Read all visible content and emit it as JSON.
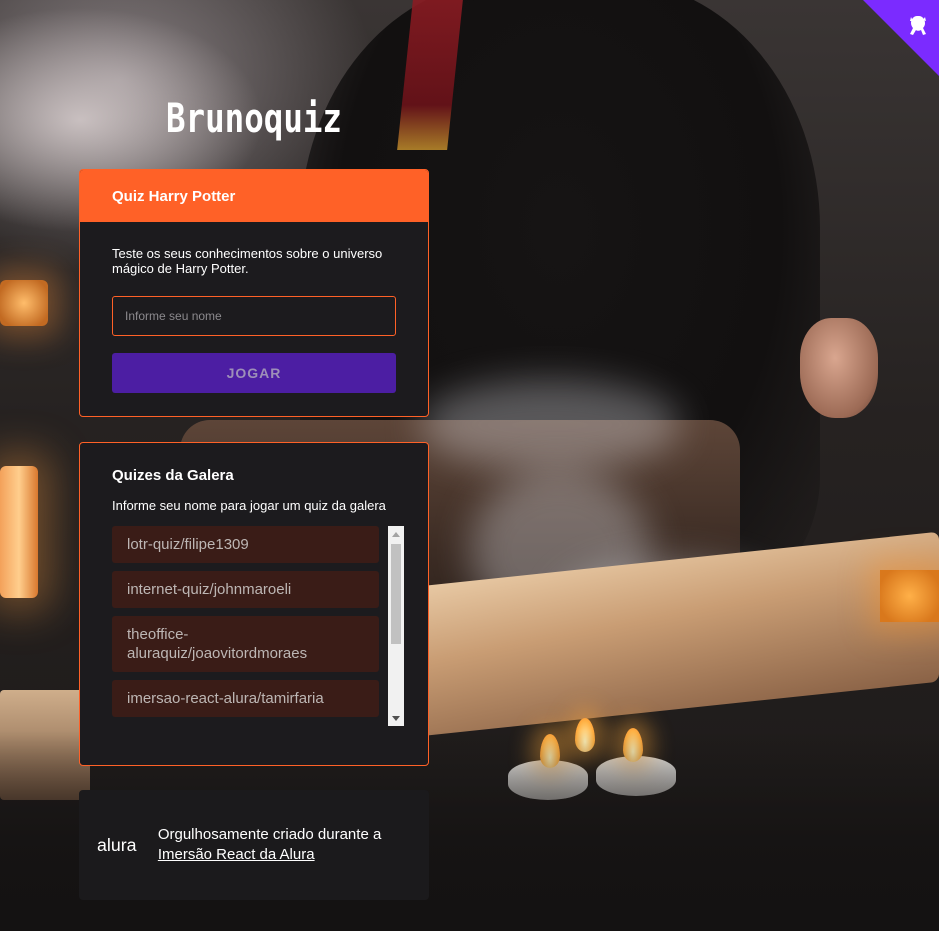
{
  "app": {
    "logo_text": "Brunoquiz"
  },
  "quiz_card": {
    "title": "Quiz Harry Potter",
    "description": "Teste os seus conhecimentos sobre o universo mágico de Harry Potter.",
    "name_input": {
      "placeholder": "Informe seu nome",
      "value": ""
    },
    "play_button_label": "JOGAR"
  },
  "community": {
    "title": "Quizes da Galera",
    "subtitle": "Informe seu nome para jogar um quiz da galera",
    "items": [
      {
        "label": "lotr-quiz/filipe1309"
      },
      {
        "label": "internet-quiz/johnmaroeli"
      },
      {
        "label": "theoffice-aluraquiz/joaovitordmoraes"
      },
      {
        "label": "imersao-react-alura/tamirfaria"
      }
    ]
  },
  "footer": {
    "logo_text": "alura",
    "text_line": "Orgulhosamente criado durante a ",
    "link_text": "Imersão React da Alura"
  },
  "colors": {
    "primary": "#ff6127",
    "secondary": "#4c1ea3",
    "card_bg": "#1c1b1e",
    "list_item_bg": "#3a1c17",
    "github_corner": "#7b2bff"
  },
  "icons": {
    "github_corner": "octocat-icon"
  }
}
